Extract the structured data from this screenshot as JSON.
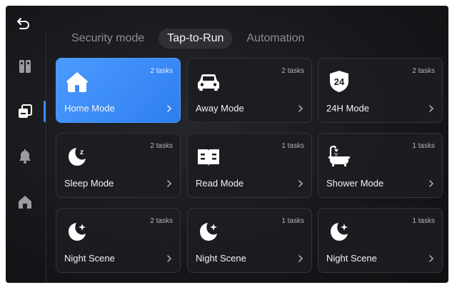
{
  "nav": {
    "back_icon": "back-arrow-icon"
  },
  "sidebar": {
    "items": [
      {
        "icon": "devices-icon",
        "active": false
      },
      {
        "icon": "scenes-icon",
        "active": true
      },
      {
        "icon": "bell-icon",
        "active": false
      },
      {
        "icon": "home-icon",
        "active": false
      }
    ]
  },
  "tabs": [
    {
      "label": "Security mode",
      "active": false
    },
    {
      "label": "Tap-to-Run",
      "active": true
    },
    {
      "label": "Automation",
      "active": false
    }
  ],
  "cards": [
    {
      "name": "Home Mode",
      "tasks": "2 tasks",
      "icon": "house-icon",
      "active": true
    },
    {
      "name": "Away Mode",
      "tasks": "2 tasks",
      "icon": "car-icon",
      "active": false
    },
    {
      "name": "24H Mode",
      "tasks": "2 tasks",
      "icon": "24h-icon",
      "active": false
    },
    {
      "name": "Sleep Mode",
      "tasks": "2 tasks",
      "icon": "moon-z-icon",
      "active": false
    },
    {
      "name": "Read Mode",
      "tasks": "1 tasks",
      "icon": "book-icon",
      "active": false
    },
    {
      "name": "Shower Mode",
      "tasks": "1 tasks",
      "icon": "bathtub-icon",
      "active": false
    },
    {
      "name": "Night Scene",
      "tasks": "2 tasks",
      "icon": "moon-star-icon",
      "active": false
    },
    {
      "name": "Night Scene",
      "tasks": "1 tasks",
      "icon": "moon-star-icon",
      "active": false
    },
    {
      "name": "Night Scene",
      "tasks": "1 tasks",
      "icon": "moon-star-icon",
      "active": false
    }
  ],
  "colors": {
    "accent": "#3a86ff",
    "card_active": "#3d8df8",
    "background": "#17181b"
  }
}
